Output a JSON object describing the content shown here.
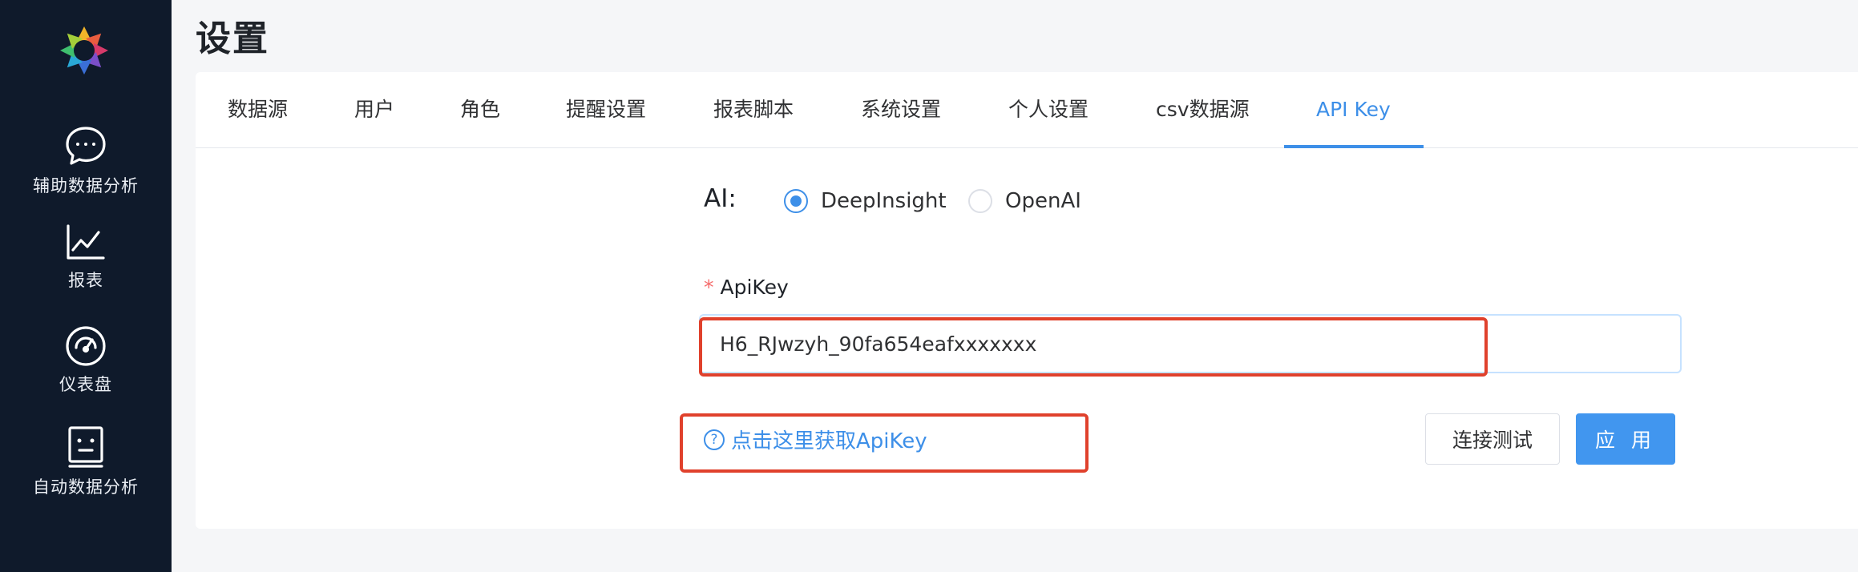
{
  "page": {
    "title": "设置"
  },
  "sidebar": {
    "logo": "logo-icon",
    "items": [
      {
        "label": "辅助数据分析",
        "icon": "chat-bubble-icon"
      },
      {
        "label": "报表",
        "icon": "line-chart-icon"
      },
      {
        "label": "仪表盘",
        "icon": "gauge-icon"
      },
      {
        "label": "自动数据分析",
        "icon": "robot-icon"
      }
    ]
  },
  "tabs": [
    {
      "label": "数据源"
    },
    {
      "label": "用户"
    },
    {
      "label": "角色"
    },
    {
      "label": "提醒设置"
    },
    {
      "label": "报表脚本"
    },
    {
      "label": "系统设置"
    },
    {
      "label": "个人设置"
    },
    {
      "label": "csv数据源"
    },
    {
      "label": "API Key",
      "active": true
    }
  ],
  "ai": {
    "label": "AI:",
    "options": [
      {
        "label": "DeepInsight",
        "checked": true
      },
      {
        "label": "OpenAI",
        "checked": false
      }
    ]
  },
  "apikey": {
    "required_mark": "*",
    "label": "ApiKey",
    "value": "H6_RJwzyh_90fa654eafxxxxxxx"
  },
  "help_link": {
    "icon": "question-circle-icon",
    "text": "点击这里获取ApiKey"
  },
  "buttons": {
    "test": "连接测试",
    "apply": "应 用"
  },
  "colors": {
    "sidebar_bg": "#0f1a2b",
    "accent": "#3d8fe8",
    "highlight": "#e0412c"
  }
}
